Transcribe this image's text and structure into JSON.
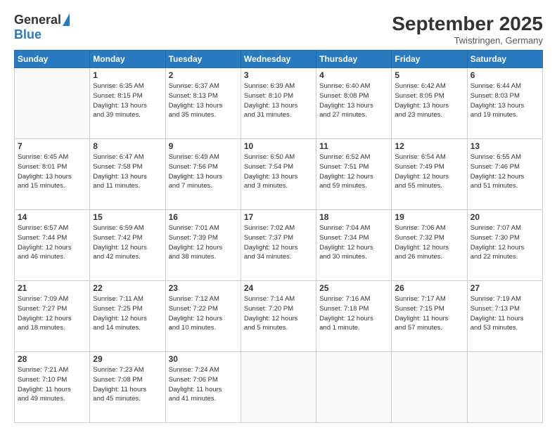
{
  "logo": {
    "general": "General",
    "blue": "Blue"
  },
  "title": {
    "month_year": "September 2025",
    "location": "Twistringen, Germany"
  },
  "header": {
    "days": [
      "Sunday",
      "Monday",
      "Tuesday",
      "Wednesday",
      "Thursday",
      "Friday",
      "Saturday"
    ]
  },
  "weeks": [
    [
      {
        "day": "",
        "info": ""
      },
      {
        "day": "1",
        "info": "Sunrise: 6:35 AM\nSunset: 8:15 PM\nDaylight: 13 hours\nand 39 minutes."
      },
      {
        "day": "2",
        "info": "Sunrise: 6:37 AM\nSunset: 8:13 PM\nDaylight: 13 hours\nand 35 minutes."
      },
      {
        "day": "3",
        "info": "Sunrise: 6:39 AM\nSunset: 8:10 PM\nDaylight: 13 hours\nand 31 minutes."
      },
      {
        "day": "4",
        "info": "Sunrise: 6:40 AM\nSunset: 8:08 PM\nDaylight: 13 hours\nand 27 minutes."
      },
      {
        "day": "5",
        "info": "Sunrise: 6:42 AM\nSunset: 8:05 PM\nDaylight: 13 hours\nand 23 minutes."
      },
      {
        "day": "6",
        "info": "Sunrise: 6:44 AM\nSunset: 8:03 PM\nDaylight: 13 hours\nand 19 minutes."
      }
    ],
    [
      {
        "day": "7",
        "info": "Sunrise: 6:45 AM\nSunset: 8:01 PM\nDaylight: 13 hours\nand 15 minutes."
      },
      {
        "day": "8",
        "info": "Sunrise: 6:47 AM\nSunset: 7:58 PM\nDaylight: 13 hours\nand 11 minutes."
      },
      {
        "day": "9",
        "info": "Sunrise: 6:49 AM\nSunset: 7:56 PM\nDaylight: 13 hours\nand 7 minutes."
      },
      {
        "day": "10",
        "info": "Sunrise: 6:50 AM\nSunset: 7:54 PM\nDaylight: 13 hours\nand 3 minutes."
      },
      {
        "day": "11",
        "info": "Sunrise: 6:52 AM\nSunset: 7:51 PM\nDaylight: 12 hours\nand 59 minutes."
      },
      {
        "day": "12",
        "info": "Sunrise: 6:54 AM\nSunset: 7:49 PM\nDaylight: 12 hours\nand 55 minutes."
      },
      {
        "day": "13",
        "info": "Sunrise: 6:55 AM\nSunset: 7:46 PM\nDaylight: 12 hours\nand 51 minutes."
      }
    ],
    [
      {
        "day": "14",
        "info": "Sunrise: 6:57 AM\nSunset: 7:44 PM\nDaylight: 12 hours\nand 46 minutes."
      },
      {
        "day": "15",
        "info": "Sunrise: 6:59 AM\nSunset: 7:42 PM\nDaylight: 12 hours\nand 42 minutes."
      },
      {
        "day": "16",
        "info": "Sunrise: 7:01 AM\nSunset: 7:39 PM\nDaylight: 12 hours\nand 38 minutes."
      },
      {
        "day": "17",
        "info": "Sunrise: 7:02 AM\nSunset: 7:37 PM\nDaylight: 12 hours\nand 34 minutes."
      },
      {
        "day": "18",
        "info": "Sunrise: 7:04 AM\nSunset: 7:34 PM\nDaylight: 12 hours\nand 30 minutes."
      },
      {
        "day": "19",
        "info": "Sunrise: 7:06 AM\nSunset: 7:32 PM\nDaylight: 12 hours\nand 26 minutes."
      },
      {
        "day": "20",
        "info": "Sunrise: 7:07 AM\nSunset: 7:30 PM\nDaylight: 12 hours\nand 22 minutes."
      }
    ],
    [
      {
        "day": "21",
        "info": "Sunrise: 7:09 AM\nSunset: 7:27 PM\nDaylight: 12 hours\nand 18 minutes."
      },
      {
        "day": "22",
        "info": "Sunrise: 7:11 AM\nSunset: 7:25 PM\nDaylight: 12 hours\nand 14 minutes."
      },
      {
        "day": "23",
        "info": "Sunrise: 7:12 AM\nSunset: 7:22 PM\nDaylight: 12 hours\nand 10 minutes."
      },
      {
        "day": "24",
        "info": "Sunrise: 7:14 AM\nSunset: 7:20 PM\nDaylight: 12 hours\nand 5 minutes."
      },
      {
        "day": "25",
        "info": "Sunrise: 7:16 AM\nSunset: 7:18 PM\nDaylight: 12 hours\nand 1 minute."
      },
      {
        "day": "26",
        "info": "Sunrise: 7:17 AM\nSunset: 7:15 PM\nDaylight: 11 hours\nand 57 minutes."
      },
      {
        "day": "27",
        "info": "Sunrise: 7:19 AM\nSunset: 7:13 PM\nDaylight: 11 hours\nand 53 minutes."
      }
    ],
    [
      {
        "day": "28",
        "info": "Sunrise: 7:21 AM\nSunset: 7:10 PM\nDaylight: 11 hours\nand 49 minutes."
      },
      {
        "day": "29",
        "info": "Sunrise: 7:23 AM\nSunset: 7:08 PM\nDaylight: 11 hours\nand 45 minutes."
      },
      {
        "day": "30",
        "info": "Sunrise: 7:24 AM\nSunset: 7:06 PM\nDaylight: 11 hours\nand 41 minutes."
      },
      {
        "day": "",
        "info": ""
      },
      {
        "day": "",
        "info": ""
      },
      {
        "day": "",
        "info": ""
      },
      {
        "day": "",
        "info": ""
      }
    ]
  ]
}
